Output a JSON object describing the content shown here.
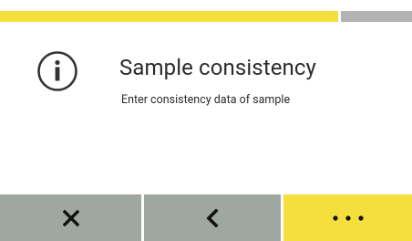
{
  "progress": {
    "fraction": 0.82,
    "fill_color": "#f5df3c",
    "track_color": "#b3b3b3"
  },
  "content": {
    "icon": "info-icon",
    "title": "Sample consistency",
    "subtitle": "Enter consistency data of sample"
  },
  "buttons": {
    "cancel": {
      "icon": "close-icon",
      "color": "#9ea7a0"
    },
    "back": {
      "icon": "chevron-left-icon",
      "color": "#9ea7a0"
    },
    "more": {
      "icon": "more-dots-icon",
      "color": "#f5df3c"
    }
  }
}
